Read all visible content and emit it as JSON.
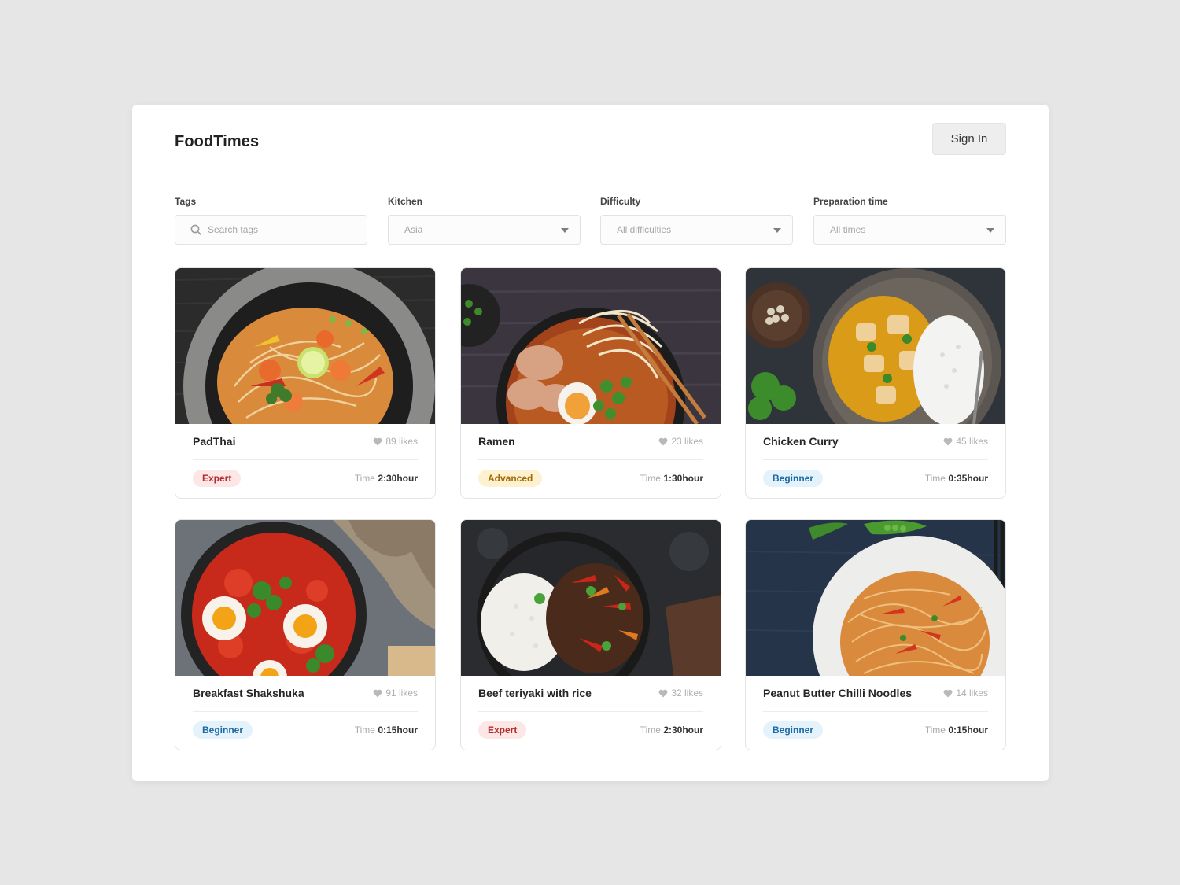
{
  "app": {
    "brand": "FoodTimes",
    "signin_label": "Sign In"
  },
  "filters": {
    "tags": {
      "label": "Tags",
      "placeholder": "Search tags"
    },
    "kitchen": {
      "label": "Kitchen",
      "value": "Asia"
    },
    "difficulty": {
      "label": "Difficulty",
      "value": "All difficulties"
    },
    "prep": {
      "label": "Preparation time",
      "value": "All times"
    }
  },
  "time_label": "Time",
  "recipes": [
    {
      "title": "PadThai",
      "likes": "89 likes",
      "difficulty": "Expert",
      "time": "2:30hour"
    },
    {
      "title": "Ramen",
      "likes": "23 likes",
      "difficulty": "Advanced",
      "time": "1:30hour"
    },
    {
      "title": "Chicken Curry",
      "likes": "45 likes",
      "difficulty": "Beginner",
      "time": "0:35hour"
    },
    {
      "title": "Breakfast Shakshuka",
      "likes": "91 likes",
      "difficulty": "Beginner",
      "time": "0:15hour"
    },
    {
      "title": "Beef teriyaki with rice",
      "likes": "32 likes",
      "difficulty": "Expert",
      "time": "2:30hour"
    },
    {
      "title": "Peanut Butter Chilli Noodles",
      "likes": "14 likes",
      "difficulty": "Beginner",
      "time": "0:15hour"
    }
  ],
  "colors": {
    "page_bg": "#e6e6e6",
    "expert": "#b52a2a",
    "advanced": "#a06a06",
    "beginner": "#1c6aa3"
  }
}
